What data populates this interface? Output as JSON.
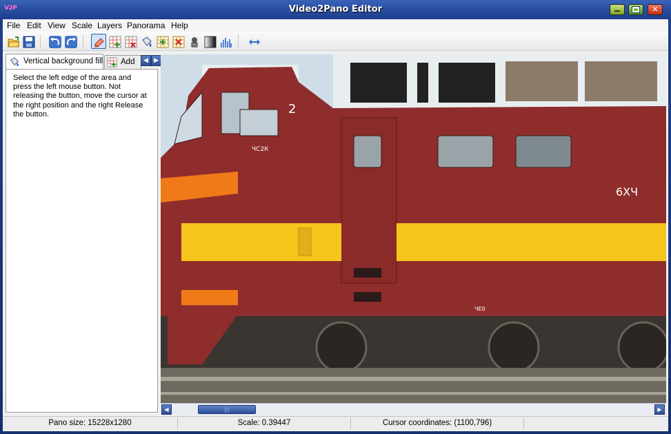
{
  "window": {
    "title": "Video2Pano  Editor",
    "icon_text": "V2P",
    "controls": [
      "minimize-icon",
      "maximize-icon",
      "close-icon"
    ]
  },
  "menu": {
    "items": [
      "File",
      "Edit",
      "View",
      "Scale",
      "Layers",
      "Panorama",
      "Help"
    ]
  },
  "toolbar": {
    "buttons": [
      {
        "icon": "open-folder-icon"
      },
      {
        "icon": "save-icon"
      },
      {
        "icon": "undo-icon"
      },
      {
        "icon": "redo-icon"
      },
      {
        "icon": "eraser-tool-icon",
        "active": true
      },
      {
        "icon": "add-region-icon"
      },
      {
        "icon": "remove-region-icon"
      },
      {
        "icon": "vertical-fill-icon"
      },
      {
        "icon": "add-layer-icon"
      },
      {
        "icon": "delete-layer-icon"
      },
      {
        "icon": "stamp-icon"
      },
      {
        "icon": "gradient-icon"
      },
      {
        "icon": "histogram-icon"
      },
      {
        "icon": "stretch-horizontal-icon"
      }
    ]
  },
  "left_panel": {
    "tabs": [
      {
        "label": "Vertical background fill",
        "icon": "vertical-fill-icon",
        "active": true
      },
      {
        "label": "Add",
        "icon": "add-region-icon",
        "active": false
      }
    ],
    "instructions": "Select the left edge of the area and press the left mouse button. Not releasing the button, move the cursor at the right position and the right Release the button."
  },
  "scrollbar": {
    "position": 0.06,
    "visible_fraction": 0.12
  },
  "status": {
    "pano_size": "Pano size: 15228x1280",
    "scale": "Scale: 0.39447",
    "cursor": "Cursor coordinates: (1100,796)"
  },
  "image": {
    "number_plate": "2",
    "side_text_front": "ЧС2К",
    "side_text_right": "6ХЧ",
    "under_text": "ЧЕ0",
    "colors": {
      "body": "#8e2d2c",
      "stripe": "#f6c51c",
      "orange": "#f07a17",
      "roof": "#e8eef0",
      "rails": "#6f6a60"
    }
  }
}
